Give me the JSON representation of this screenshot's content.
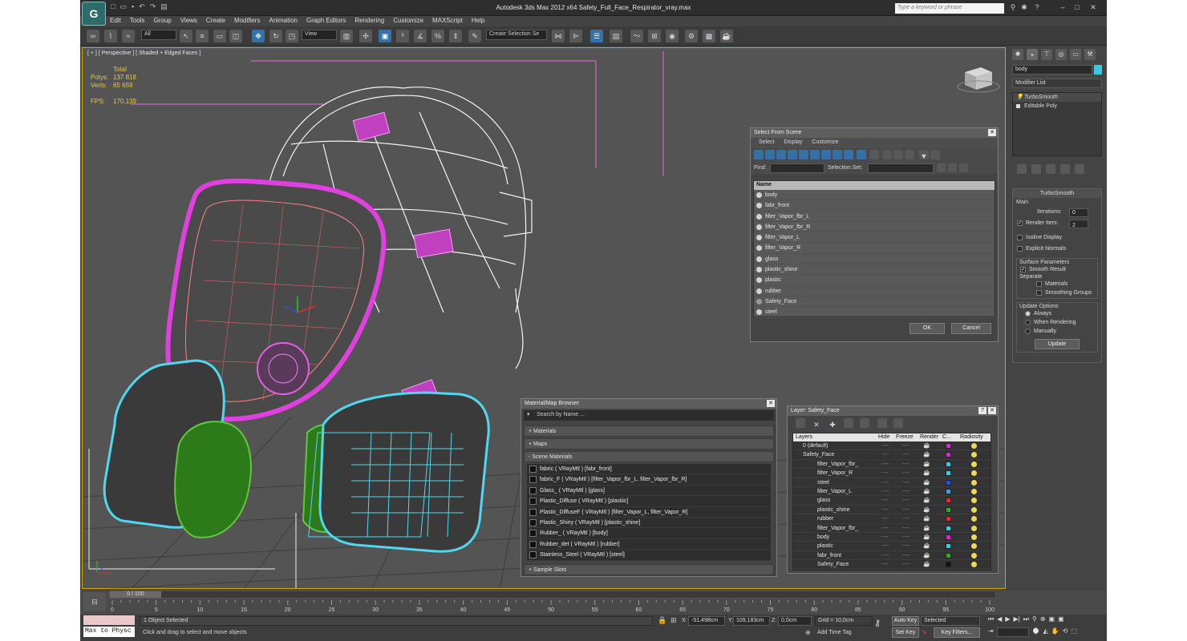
{
  "window": {
    "title": "Autodesk 3ds Max  2012 x64     Safety_Full_Face_Respirator_vray.max",
    "search_placeholder": "Type a keyword or phrase"
  },
  "menu": [
    "Edit",
    "Tools",
    "Group",
    "Views",
    "Create",
    "Modifiers",
    "Animation",
    "Graph Editors",
    "Rendering",
    "Customize",
    "MAXScript",
    "Help"
  ],
  "toolbar": {
    "filter": "All",
    "view": "View",
    "selection_set": "Create Selection Se"
  },
  "viewport": {
    "label": "[ + ] [ Perspective ] [ Shaded + Edged Faces ]",
    "stats": {
      "total_header": "Total",
      "polys_label": "Polys:",
      "polys": "137 818",
      "verts_label": "Verts:",
      "verts": "65 659",
      "fps_label": "FPS:",
      "fps": "170,139"
    }
  },
  "select_from_scene": {
    "title": "Select From Scene",
    "menus": [
      "Select",
      "Display",
      "Customize"
    ],
    "find_label": "Find:",
    "selection_set_label": "Selection Set:",
    "column": "Name",
    "items": [
      "body",
      "fabr_front",
      "filter_Vapor_fbr_L",
      "filter_Vapor_fbr_R",
      "filter_Vapor_L",
      "filter_Vapor_R",
      "glass",
      "plastic_shine",
      "plastic",
      "rubber",
      "Safety_Face",
      "steel"
    ],
    "ok": "OK",
    "cancel": "Cancel"
  },
  "material_browser": {
    "title": "Material/Map Browser",
    "search": "Search by Name ...",
    "sections": {
      "materials": "+ Materials",
      "maps": "+ Maps",
      "scene": "- Scene Materials",
      "samples": "+ Sample Slots"
    },
    "scene_materials": [
      "fabric  ( VRayMtl ) [fabr_front]",
      "fabric_F  ( VRayMtl ) [filter_Vapor_fbr_L, filter_Vapor_fbr_R]",
      "Glass_  ( VRayMtl ) [glass]",
      "Plastic_Diffuse  ( VRayMtl ) [plastiic]",
      "Plastic_DiffuseF  ( VRayMtl ) [filter_Vapor_L, filter_Vapor_R]",
      "Plastic_Shiny  ( VRayMtl ) [plastic_shine]",
      "Rubber_  ( VRayMtl ) [body]",
      "Rubber_det  ( VRayMtl ) [rubber]",
      "Stainless_Steel  ( VRayMtl ) [steel]"
    ]
  },
  "layer_manager": {
    "title": "Layer: Safety_Face",
    "help": "?",
    "columns": {
      "layers": "Layers",
      "hide": "Hide",
      "freeze": "Freeze",
      "render": "Render",
      "color": "C...",
      "radiosity": "Radiosity"
    },
    "rows": [
      {
        "name": "0 (default)",
        "color": "#c832c8",
        "indent": 1
      },
      {
        "name": "Safety_Face",
        "color": "#c832c8",
        "indent": 1
      },
      {
        "name": "filter_Vapor_fbr_",
        "color": "#40c8e0",
        "indent": 2
      },
      {
        "name": "filter_Vapor_R",
        "color": "#40c8e0",
        "indent": 2
      },
      {
        "name": "steel",
        "color": "#3050c8",
        "indent": 2
      },
      {
        "name": "filter_Vapor_L",
        "color": "#40a0e0",
        "indent": 2
      },
      {
        "name": "glass",
        "color": "#e03030",
        "indent": 2
      },
      {
        "name": "plastic_shine",
        "color": "#30a830",
        "indent": 2
      },
      {
        "name": "rubber",
        "color": "#d83030",
        "indent": 2
      },
      {
        "name": "filter_Vapor_fbr_",
        "color": "#40c8e0",
        "indent": 2
      },
      {
        "name": "body",
        "color": "#c832c8",
        "indent": 2
      },
      {
        "name": "plastic",
        "color": "#40c8e0",
        "indent": 2
      },
      {
        "name": "fabr_front",
        "color": "#30a830",
        "indent": 2
      },
      {
        "name": "Safety_Face",
        "color": "#111111",
        "indent": 2
      }
    ],
    "dash": "----"
  },
  "command_panel": {
    "object_name": "body",
    "modifier_list": "Modifier List",
    "stack": [
      "TurboSmooth",
      "Editable Poly"
    ],
    "turbosmooth": {
      "title": "TurboSmooth",
      "main": "Main",
      "iterations_label": "Iterations:",
      "iterations": "0",
      "render_iters_label": "Render Iters:",
      "render_iters": "2",
      "isoline": "Isoline Display",
      "explicit": "Explicit Normals",
      "surface_params": "Surface Parameters",
      "smooth_result": "Smooth Result",
      "separate": "Separate",
      "materials": "Materials",
      "smoothing_groups": "Smoothing Groups",
      "update_options": "Update Options",
      "always": "Always",
      "when_rendering": "When Rendering",
      "manually": "Manually",
      "update": "Update"
    }
  },
  "timeline": {
    "frame": "0 / 100",
    "ticks": [
      "0",
      "5",
      "10",
      "15",
      "20",
      "25",
      "30",
      "35",
      "40",
      "45",
      "50",
      "55",
      "60",
      "65",
      "70",
      "75",
      "80",
      "85",
      "90",
      "95",
      "100"
    ]
  },
  "status": {
    "script_label": "Max to Physc",
    "selected": "1 Object Selected",
    "prompt": "Click and drag to select and move objects",
    "x_label": "X:",
    "x": "-51,498cm",
    "y_label": "Y:",
    "y": "109,183cm",
    "z_label": "Z:",
    "z": "0,0cm",
    "grid": "Grid = 10,0cm",
    "add_time_tag": "Add Time Tag",
    "auto_key": "Auto Key",
    "set_key": "Set Key",
    "selected_dd": "Selected",
    "key_filters": "Key Filters..."
  }
}
